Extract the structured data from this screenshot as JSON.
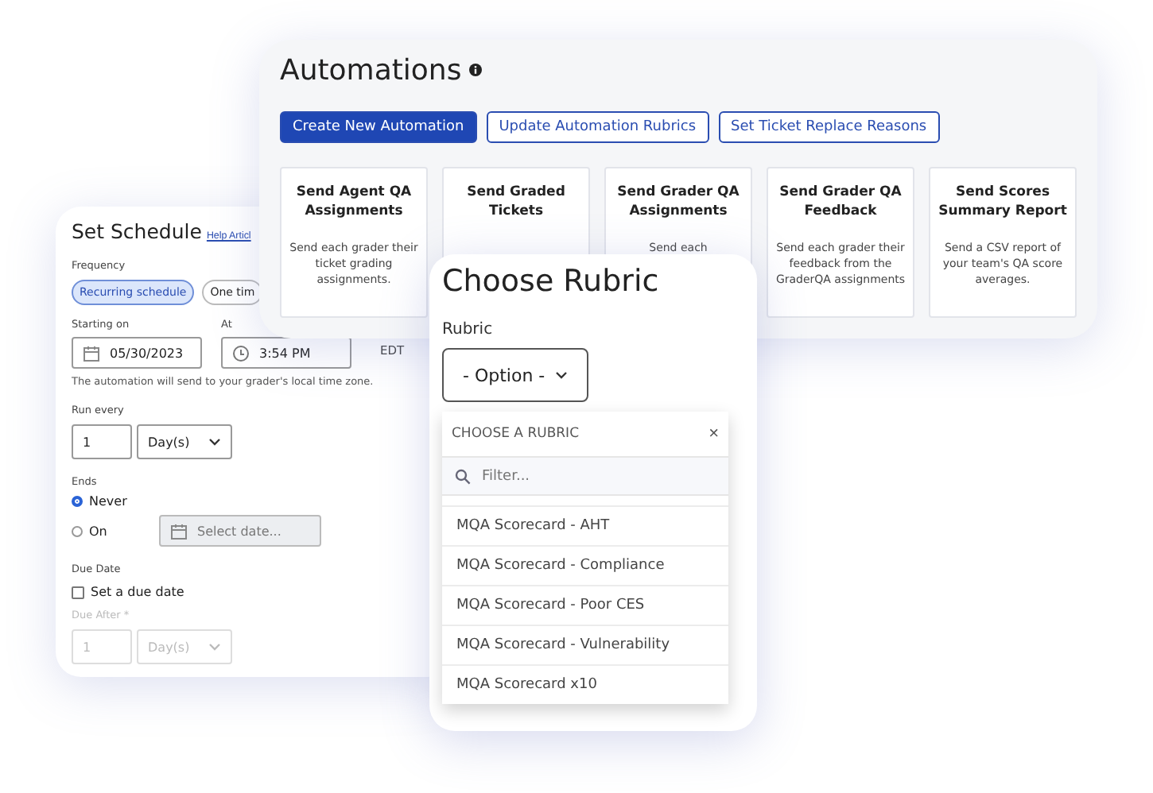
{
  "automations": {
    "title": "Automations",
    "buttons": [
      {
        "label": "Create New Automation",
        "kind": "primary"
      },
      {
        "label": "Update Automation Rubrics",
        "kind": "outline"
      },
      {
        "label": "Set Ticket Replace Reasons",
        "kind": "outline"
      }
    ],
    "cards": [
      {
        "title": "Send Agent QA Assignments",
        "description": "Send each grader their ticket grading assignments."
      },
      {
        "title": "Send Graded Tickets"
      },
      {
        "title": "Send Grader QA Assignments",
        "description": "Send each"
      },
      {
        "title": "Send Grader QA Feedback",
        "description": "Send each grader their feedback from the GraderQA assignments"
      },
      {
        "title": "Send Scores Summary Report",
        "description": "Send a CSV report of your team's QA score averages."
      }
    ]
  },
  "schedule": {
    "title": "Set Schedule",
    "help_link": "Help Articl",
    "frequency_label": "Frequency",
    "frequency_options": [
      {
        "label": "Recurring schedule",
        "selected": true
      },
      {
        "label": "One tim",
        "selected": false
      }
    ],
    "start_label": "Starting on",
    "start_date": "05/30/2023",
    "time_label": "At",
    "time": "3:54 PM",
    "timezone": "EDT",
    "note": "The automation will send to your grader's local time zone.",
    "run_every_label": "Run every",
    "run_every_value": "1",
    "run_every_unit": "Day(s)",
    "ends_label": "Ends",
    "ends_options": [
      {
        "label": "Never",
        "selected": true
      },
      {
        "label": "On",
        "selected": false
      }
    ],
    "end_date_placeholder": "Select date...",
    "due_date_label": "Due Date",
    "due_checkbox": {
      "label": "Set a due date",
      "checked": false
    },
    "due_after_label": "Due After *",
    "due_after_value": "1",
    "due_after_unit": "Day(s)",
    "due_after_disabled": true
  },
  "rubric": {
    "title": "Choose Rubric",
    "field_label": "Rubric",
    "select_value": "- Option -",
    "dropdown_header": "CHOOSE A RUBRIC",
    "close": "×",
    "filter_placeholder": "Filter...",
    "options": [
      "MQA Scorecard - AHT",
      "MQA Scorecard - Compliance",
      "MQA Scorecard - Poor CES",
      "MQA Scorecard - Vulnerability",
      "MQA Scorecard x10"
    ]
  }
}
